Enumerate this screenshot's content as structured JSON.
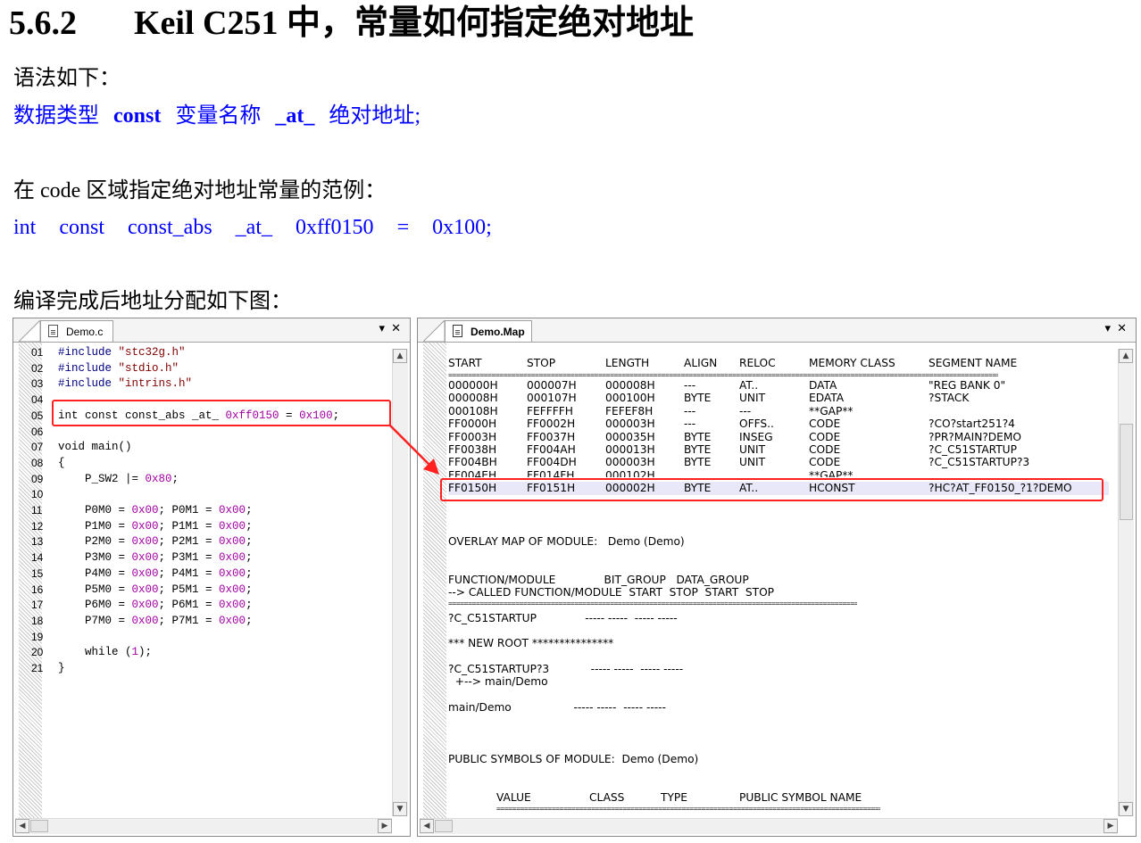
{
  "heading": {
    "number": "5.6.2",
    "title": "Keil C251 中，常量如何指定绝对地址"
  },
  "syntax": {
    "intro": "语法如下：",
    "part1": "数据类型",
    "part2": "const",
    "part3": "变量名称",
    "part4": "_at_",
    "part5": "绝对地址;"
  },
  "example": {
    "intro": "在 code 区域指定绝对地址常量的范例：",
    "tokens": [
      "int",
      "const",
      "const_abs",
      "_at_",
      "0xff0150",
      "=",
      "0x100;"
    ]
  },
  "caption": "编译完成后地址分配如下图：",
  "colors": {
    "accent_blue": "#0000ff",
    "highlight_red": "#ff2020",
    "map_highlight": "#e8e8f8"
  },
  "left_pane": {
    "tab": "Demo.c",
    "lines": [
      {
        "n": "01",
        "t": "#include \"stc32g.h\""
      },
      {
        "n": "02",
        "t": "#include \"stdio.h\""
      },
      {
        "n": "03",
        "t": "#include \"intrins.h\""
      },
      {
        "n": "04",
        "t": ""
      },
      {
        "n": "05",
        "t": "int const const_abs _at_ 0xff0150 = 0x100;"
      },
      {
        "n": "06",
        "t": ""
      },
      {
        "n": "07",
        "t": "void main()"
      },
      {
        "n": "08",
        "t": "{"
      },
      {
        "n": "09",
        "t": "    P_SW2 |= 0x80;"
      },
      {
        "n": "10",
        "t": ""
      },
      {
        "n": "11",
        "t": "    P0M0 = 0x00; P0M1 = 0x00;"
      },
      {
        "n": "12",
        "t": "    P1M0 = 0x00; P1M1 = 0x00;"
      },
      {
        "n": "13",
        "t": "    P2M0 = 0x00; P2M1 = 0x00;"
      },
      {
        "n": "14",
        "t": "    P3M0 = 0x00; P3M1 = 0x00;"
      },
      {
        "n": "15",
        "t": "    P4M0 = 0x00; P4M1 = 0x00;"
      },
      {
        "n": "16",
        "t": "    P5M0 = 0x00; P5M1 = 0x00;"
      },
      {
        "n": "17",
        "t": "    P6M0 = 0x00; P6M1 = 0x00;"
      },
      {
        "n": "18",
        "t": "    P7M0 = 0x00; P7M1 = 0x00;"
      },
      {
        "n": "19",
        "t": ""
      },
      {
        "n": "20",
        "t": "    while (1);"
      },
      {
        "n": "21",
        "t": "}"
      }
    ]
  },
  "right_pane": {
    "tab": "Demo.Map",
    "headers": [
      "START",
      "STOP",
      "LENGTH",
      "ALIGN",
      "RELOC",
      "MEMORY CLASS",
      "SEGMENT NAME"
    ],
    "rows": [
      [
        "000000H",
        "000007H",
        "000008H",
        "---",
        "AT..",
        "DATA",
        "\"REG BANK 0\""
      ],
      [
        "000008H",
        "000107H",
        "000100H",
        "BYTE",
        "UNIT",
        "EDATA",
        "?STACK"
      ],
      [
        "000108H",
        "FEFFFFH",
        "FEFEF8H",
        "---",
        "---",
        "**GAP**",
        ""
      ],
      [
        "FF0000H",
        "FF0002H",
        "000003H",
        "---",
        "OFFS..",
        "CODE",
        "?CO?start251?4"
      ],
      [
        "FF0003H",
        "FF0037H",
        "000035H",
        "BYTE",
        "INSEG",
        "CODE",
        "?PR?MAIN?DEMO"
      ],
      [
        "FF0038H",
        "FF004AH",
        "000013H",
        "BYTE",
        "UNIT",
        "CODE",
        "?C_C51STARTUP"
      ],
      [
        "FF004BH",
        "FF004DH",
        "000003H",
        "BYTE",
        "UNIT",
        "CODE",
        "?C_C51STARTUP?3"
      ],
      [
        "FF004EH",
        "FF014FH",
        "000102H",
        "",
        "",
        "**GAP**",
        ""
      ],
      [
        "FF0150H",
        "FF0151H",
        "000002H",
        "BYTE",
        "AT..",
        "HCONST",
        "?HC?AT_FF0150_?1?DEMO"
      ]
    ],
    "overlay_title": "OVERLAY MAP OF MODULE:   Demo (Demo)",
    "overlay_header1": "FUNCTION/MODULE              BIT_GROUP   DATA_GROUP",
    "overlay_header2": "--> CALLED FUNCTION/MODULE  START  STOP  START  STOP",
    "overlay_rows": [
      "?C_C51STARTUP              ----- -----  ----- -----",
      "*** NEW ROOT ***************",
      "?C_C51STARTUP?3            ----- -----  ----- -----",
      "  +--> main/Demo",
      "main/Demo                  ----- -----  ----- -----"
    ],
    "public_title": "PUBLIC SYMBOLS OF MODULE:  Demo (Demo)",
    "public_header": [
      "VALUE",
      "CLASS",
      "TYPE",
      "PUBLIC SYMBOL NAME"
    ]
  }
}
